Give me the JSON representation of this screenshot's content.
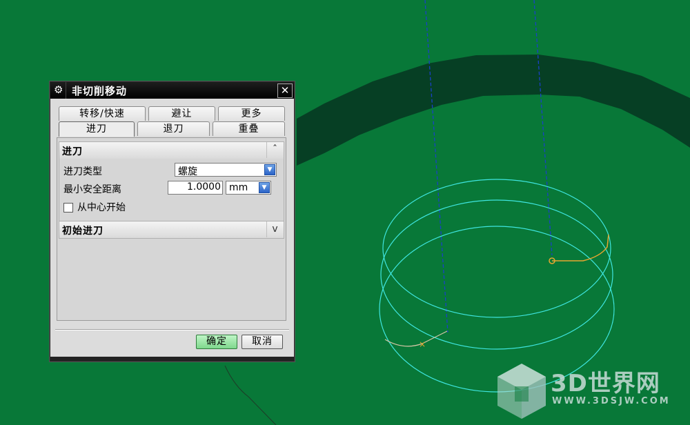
{
  "dialog": {
    "title": "非切削移动",
    "close_symbol": "✕",
    "tabs_row1": [
      "转移/快速",
      "避让",
      "更多"
    ],
    "tabs_row2": [
      "进刀",
      "退刀",
      "重叠"
    ],
    "active_tab": "进刀"
  },
  "engage_section": {
    "header": "进刀",
    "collapse_symbol": "ˆ",
    "engage_type_label": "进刀类型",
    "engage_type_value": "螺旋",
    "min_clearance_label": "最小安全距离",
    "min_clearance_value": "1.0000",
    "unit_value": "mm",
    "start_from_center_label": "从中心开始",
    "start_from_center_checked": false
  },
  "initial_section": {
    "header": "初始进刀",
    "expand_symbol": "v"
  },
  "buttons": {
    "ok": "确定",
    "cancel": "取消"
  },
  "watermark": {
    "title": "3D世界网",
    "url": "WWW.3DSJW.COM"
  },
  "colors": {
    "background": "#087838",
    "toolpath": "#3fe6e0",
    "axis_line": "#1a40c8",
    "annotation": "#e8343a",
    "engage_path": "#e8a630"
  }
}
